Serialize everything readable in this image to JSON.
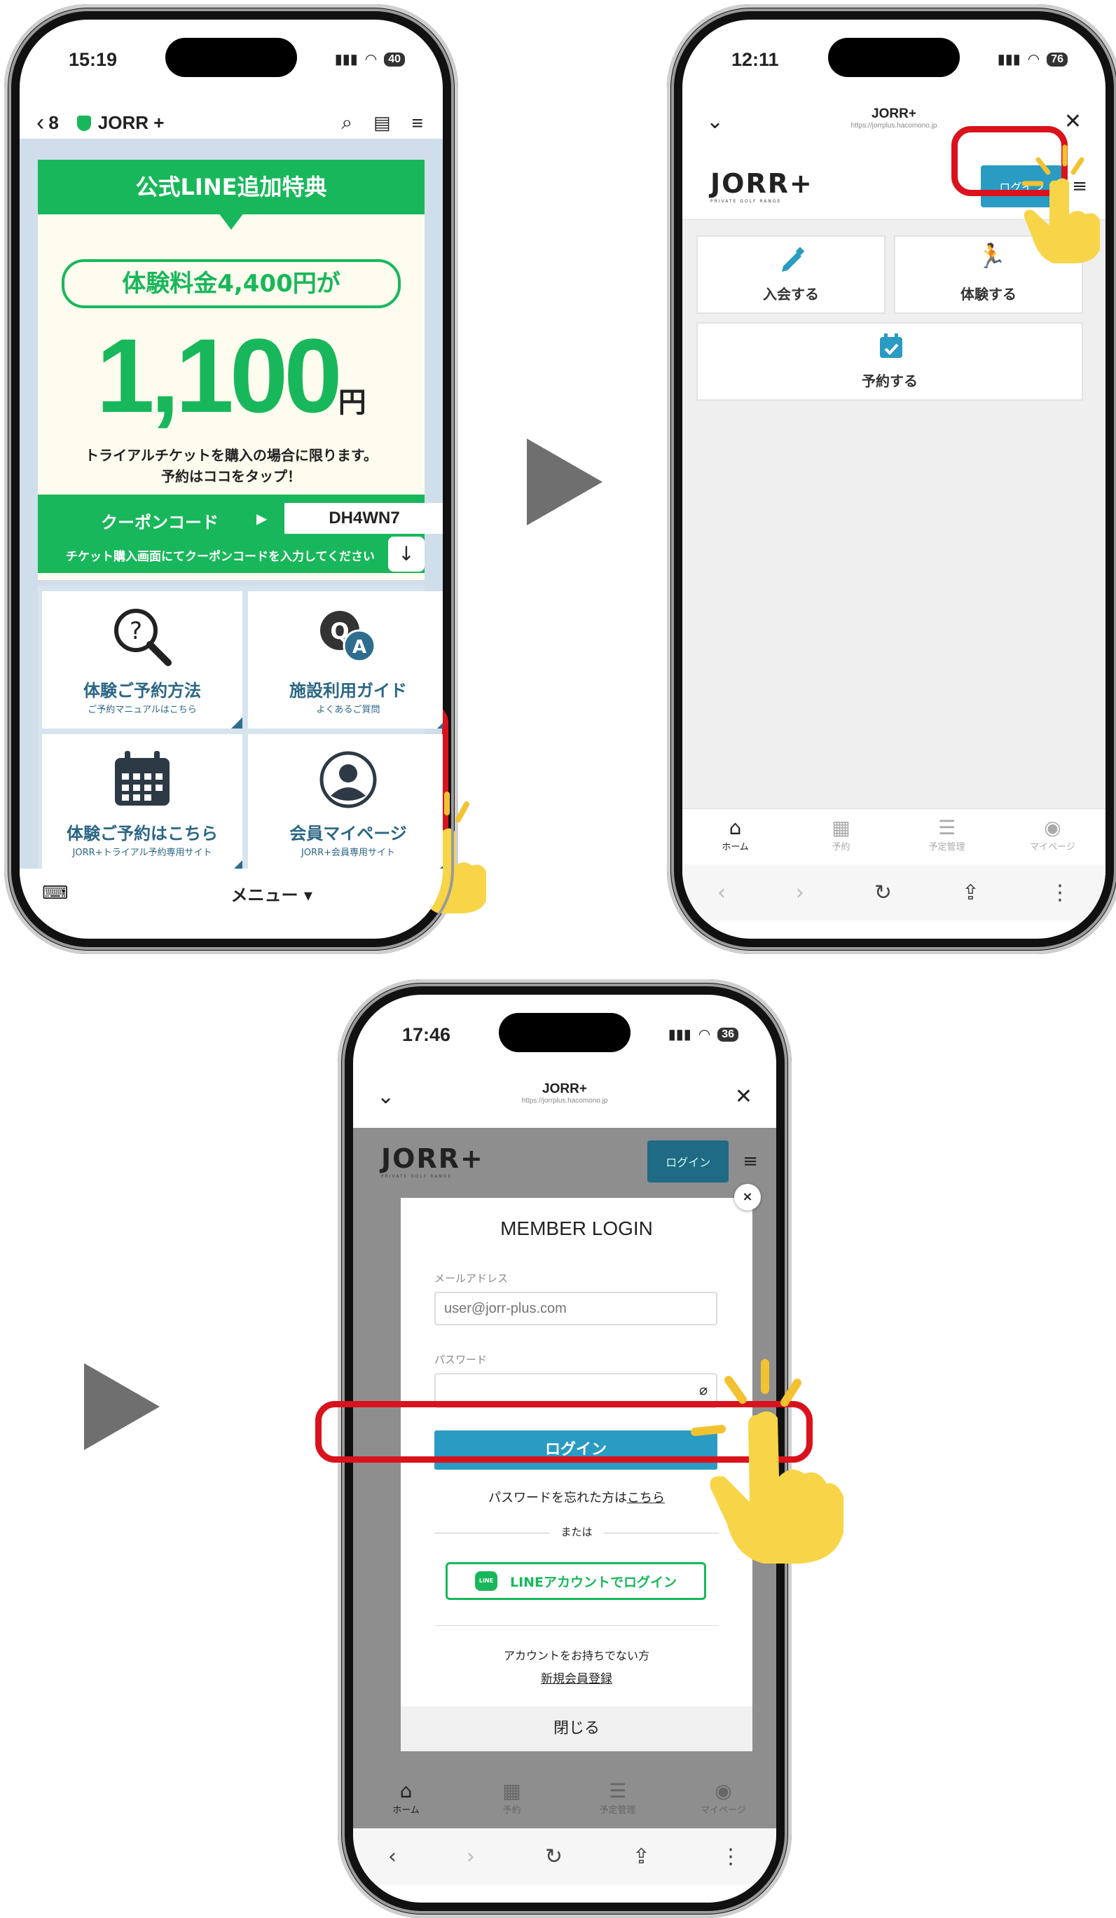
{
  "colors": {
    "line_green": "#19b75b",
    "jorr_blue": "#2a9bc3",
    "highlight_red": "#d9121c",
    "arrow_gray": "#6f6f6f",
    "tile_text": "#2b6685"
  },
  "phone1": {
    "time": "15:19",
    "battery": "40",
    "back_count": "8",
    "chat_name": "JORR +",
    "banner": {
      "header": "公式LINE追加特典",
      "pill": "体験料金4,400円が",
      "price": "1,100",
      "yen": "円",
      "note_line1": "トライアルチケットを購入の場合に限ります。",
      "note_line2": "予約はココをタップ！",
      "coupon_label": "クーポンコード",
      "coupon_code": "DH4WN7",
      "coupon_note": "チケット購入画面にてクーポンコードを入力してください"
    },
    "tiles": [
      {
        "title": "体験ご予約方法",
        "sub": "ご予約マニュアルはこちら",
        "icon": "search-question-icon"
      },
      {
        "title": "施設利用ガイド",
        "sub": "よくあるご質問",
        "icon": "qa-bubbles-icon"
      },
      {
        "title": "体験ご予約はこちら",
        "sub": "JORR+トライアル予約専用サイト",
        "icon": "calendar-icon"
      },
      {
        "title": "会員マイページ",
        "sub": "JORR+会員専用サイト",
        "icon": "user-icon"
      }
    ],
    "menu_label": "メニュー"
  },
  "phone2": {
    "time": "12:11",
    "battery": "76",
    "site_title": "JORR+",
    "url": "https://jorrplus.hacomono.jp",
    "logo": "JORR+",
    "logo_sub": "PRIVATE GOLF RANGE",
    "login_label": "ログイン",
    "cards": [
      {
        "label": "入会する",
        "icon": "pencil-icon"
      },
      {
        "label": "体験する",
        "icon": "running-icon"
      },
      {
        "label": "予約する",
        "icon": "calendar-check-icon"
      }
    ],
    "tabs": [
      {
        "label": "ホーム",
        "icon": "home-icon"
      },
      {
        "label": "予約",
        "icon": "calendar-icon"
      },
      {
        "label": "予定管理",
        "icon": "list-icon"
      },
      {
        "label": "マイページ",
        "icon": "user-circle-icon"
      }
    ]
  },
  "phone3": {
    "time": "17:46",
    "battery": "36",
    "site_title": "JORR+",
    "url": "https://jorrplus.hacomono.jp",
    "logo": "JORR+",
    "logo_sub": "PRIVATE GOLF RANGE",
    "header_login": "ログイン",
    "modal": {
      "title": "MEMBER LOGIN",
      "email_label": "メールアドレス",
      "email_placeholder": "user@jorr-plus.com",
      "password_label": "パスワード",
      "login_button": "ログイン",
      "forgot_text": "パスワードを忘れた方は",
      "forgot_link": "こちら",
      "or": "または",
      "line_login": "LINEアカウントでログイン",
      "no_account": "アカウントをお持ちでない方",
      "register": "新規会員登録",
      "close": "閉じる",
      "line_badge": "LINE"
    },
    "tabs": [
      {
        "label": "ホーム",
        "icon": "home-icon"
      },
      {
        "label": "予約",
        "icon": "calendar-icon"
      },
      {
        "label": "予定管理",
        "icon": "list-icon"
      },
      {
        "label": "マイページ",
        "icon": "user-circle-icon"
      }
    ]
  }
}
